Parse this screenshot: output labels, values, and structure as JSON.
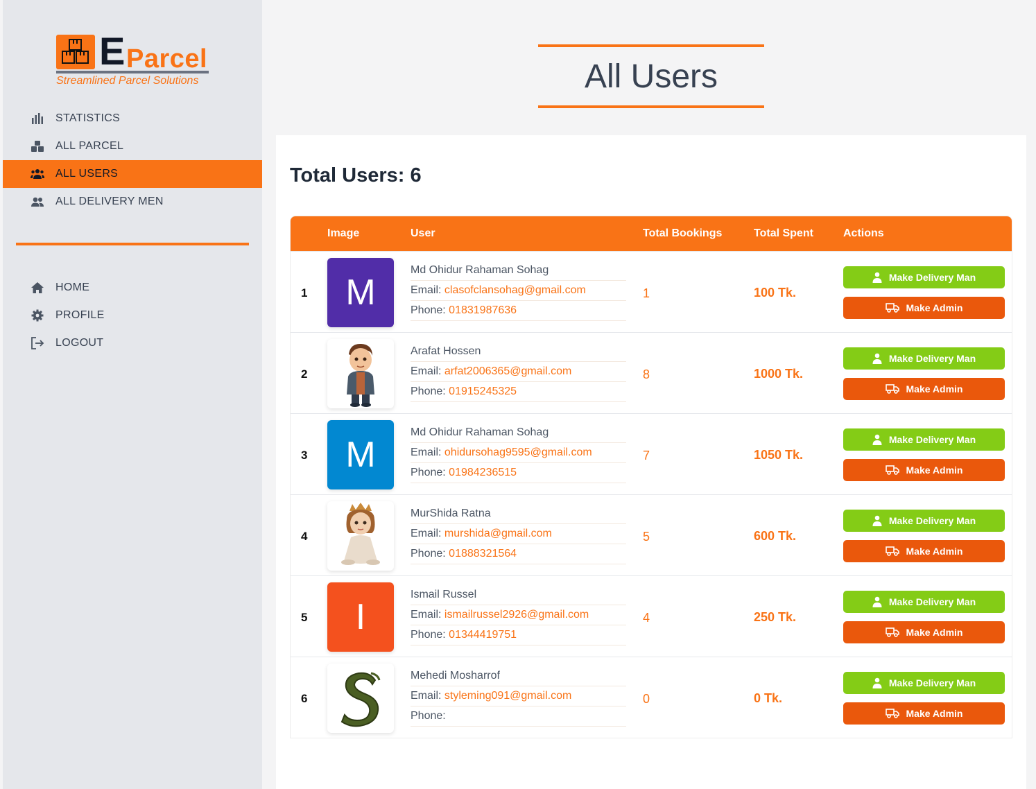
{
  "brand": {
    "letter": "E",
    "name": "Parcel",
    "tagline": "Streamlined Parcel Solutions"
  },
  "sidebar": {
    "items": [
      {
        "label": "STATISTICS",
        "icon": "bar-chart-icon",
        "active": false
      },
      {
        "label": "ALL PARCEL",
        "icon": "boxes-icon",
        "active": false
      },
      {
        "label": "ALL USERS",
        "icon": "users-icon",
        "active": true
      },
      {
        "label": "ALL DELIVERY MEN",
        "icon": "user-group-icon",
        "active": false
      }
    ],
    "secondary": [
      {
        "label": "HOME",
        "icon": "home-icon"
      },
      {
        "label": "PROFILE",
        "icon": "gear-icon"
      },
      {
        "label": "LOGOUT",
        "icon": "logout-icon"
      }
    ]
  },
  "page": {
    "title": "All Users",
    "total_label": "Total Users: 6"
  },
  "table": {
    "headers": {
      "image": "Image",
      "user": "User",
      "bookings": "Total Bookings",
      "spent": "Total Spent",
      "actions": "Actions"
    },
    "email_label": "Email:",
    "phone_label": "Phone:",
    "btn_delivery": "Make Delivery Man",
    "btn_admin": "Make Admin",
    "rows": [
      {
        "index": "1",
        "avatar_letter": "M",
        "avatar_color": "#512da8",
        "name": "Md Ohidur Rahaman Sohag",
        "email": "clasofclansohag@gmail.com",
        "phone": "01831987636",
        "bookings": "1",
        "spent": "100 Tk."
      },
      {
        "index": "2",
        "avatar_letter": "",
        "avatar_image": "boy-cartoon",
        "name": "Arafat Hossen",
        "email": "arfat2006365@gmail.com",
        "phone": "01915245325",
        "bookings": "8",
        "spent": "1000 Tk."
      },
      {
        "index": "3",
        "avatar_letter": "M",
        "avatar_color": "#0288d1",
        "name": "Md Ohidur Rahaman Sohag",
        "email": "ohidursohag9595@gmail.com",
        "phone": "01984236515",
        "bookings": "7",
        "spent": "1050 Tk."
      },
      {
        "index": "4",
        "avatar_letter": "",
        "avatar_image": "girl-crown-cartoon",
        "name": "MurShida Ratna",
        "email": "murshida@gmail.com",
        "phone": "01888321564",
        "bookings": "5",
        "spent": "600 Tk."
      },
      {
        "index": "5",
        "avatar_letter": "I",
        "avatar_color": "#f4511e",
        "name": "Ismail Russel",
        "email": "ismailrussel2926@gmail.com",
        "phone": "01344419751",
        "bookings": "4",
        "spent": "250 Tk."
      },
      {
        "index": "6",
        "avatar_letter": "",
        "avatar_image": "s-logo",
        "name": "Mehedi Mosharrof",
        "email": "styleming091@gmail.com",
        "phone": "",
        "bookings": "0",
        "spent": "0 Tk."
      }
    ]
  },
  "colors": {
    "accent": "#f97316",
    "green": "#84cc16",
    "admin": "#ea580c",
    "sidebar_bg": "#e5e7eb"
  }
}
